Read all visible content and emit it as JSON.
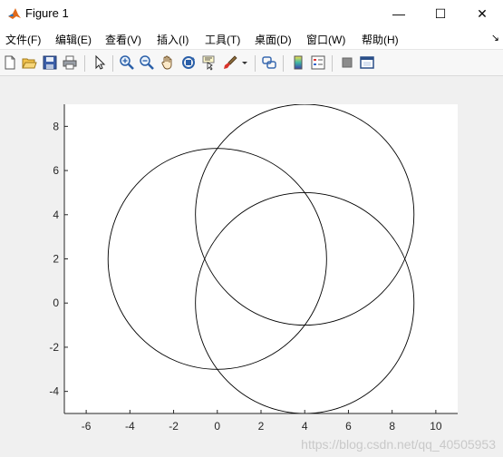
{
  "window": {
    "title": "Figure 1",
    "minimize_glyph": "—",
    "maximize_glyph": "☐",
    "close_glyph": "✕",
    "app_icon": "matlab-logo-icon"
  },
  "menubar": {
    "items": [
      {
        "label": "文件(F)"
      },
      {
        "label": "编辑(E)"
      },
      {
        "label": "查看(V)"
      },
      {
        "label": "插入(I)"
      },
      {
        "label": "工具(T)"
      },
      {
        "label": "桌面(D)"
      },
      {
        "label": "窗口(W)"
      },
      {
        "label": "帮助(H)"
      }
    ],
    "dock_glyph": "↘"
  },
  "toolbar": {
    "icons": [
      "new-figure-icon",
      "open-file-icon",
      "save-icon",
      "print-icon",
      "edit-plot-arrow-icon",
      "zoom-in-icon",
      "zoom-out-icon",
      "pan-hand-icon",
      "rotate-3d-icon",
      "data-cursor-icon",
      "brush-icon",
      "brush-dropdown-icon",
      "link-plot-icon",
      "insert-colorbar-icon",
      "insert-legend-icon",
      "hide-plot-tools-icon",
      "show-plot-tools-icon"
    ]
  },
  "chart_data": {
    "type": "line",
    "title": "",
    "xlabel": "",
    "ylabel": "",
    "xlim": [
      -7,
      11
    ],
    "ylim": [
      -5,
      9
    ],
    "xticks": [
      -6,
      -4,
      -2,
      0,
      2,
      4,
      6,
      8,
      10
    ],
    "yticks": [
      -4,
      -2,
      0,
      2,
      4,
      6,
      8
    ],
    "xtick_labels": [
      "-6",
      "-4",
      "-2",
      "0",
      "2",
      "4",
      "6",
      "8",
      "10"
    ],
    "ytick_labels": [
      "-4",
      "-2",
      "0",
      "2",
      "4",
      "6",
      "8"
    ],
    "grid": false,
    "line_color": "#000000",
    "series": [
      {
        "shape": "circle",
        "center": [
          0,
          2
        ],
        "radius": 5
      },
      {
        "shape": "circle",
        "center": [
          4,
          4
        ],
        "radius": 5
      },
      {
        "shape": "circle",
        "center": [
          4,
          0
        ],
        "radius": 5
      }
    ]
  },
  "watermark": {
    "text": "https://blog.csdn.net/qq_40505953"
  }
}
